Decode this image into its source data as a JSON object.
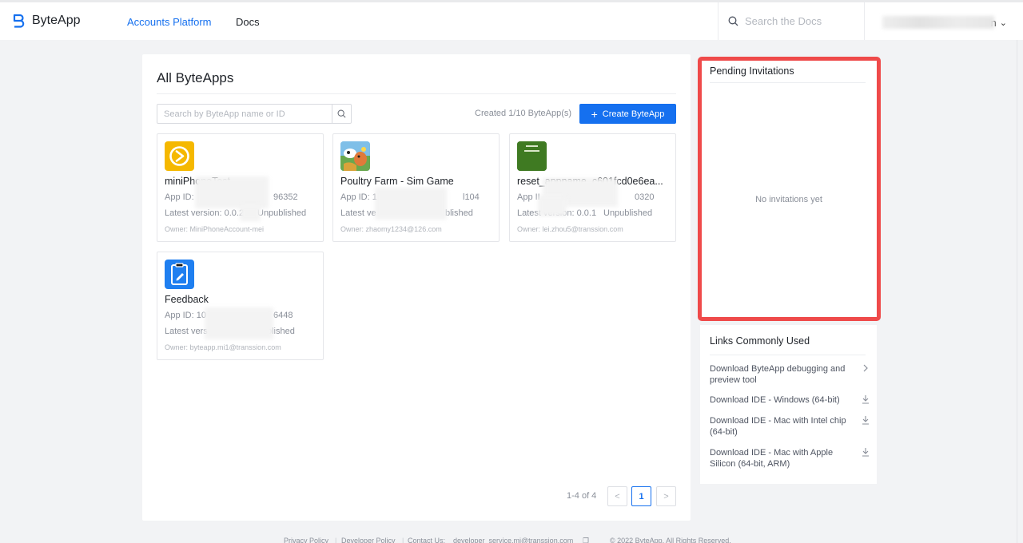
{
  "header": {
    "logo_text": "ByteApp",
    "nav": [
      {
        "label": "Accounts Platform",
        "active": true
      },
      {
        "label": "Docs",
        "active": false
      }
    ],
    "search_placeholder": "Search the Docs",
    "user_suffix": "n"
  },
  "main": {
    "title": "All ByteApps",
    "search_placeholder": "Search by ByteApp name or ID",
    "created_count": "Created 1/10 ByteApp(s)",
    "create_button": "Create ByteApp",
    "apps": [
      {
        "name": "miniPhoneTest",
        "app_id": "App ID:",
        "app_id_tail": "96352",
        "version": "Latest version: 0.0.2",
        "version_tail": "Unpublished",
        "owner": "Owner: MiniPhoneAccount-mei",
        "icon": "play-circle-icon",
        "color": "#f5b800"
      },
      {
        "name": "Poultry Farm - Sim Game",
        "app_id": "App ID: 1",
        "app_id_tail": "l104",
        "version": "Latest ve",
        "version_tail": "blished",
        "owner": "Owner: zhaomy1234@126.com",
        "icon": "farm-game-icon",
        "color": "#6aa84f"
      },
      {
        "name": "reset_appname_c601fcd0e6ea...",
        "app_id": "App II",
        "app_id_tail": "0320",
        "version": "Latest version: 0.0.1",
        "version_tail": "Unpublished",
        "owner": "Owner: lei.zhou5@transsion.com",
        "icon": "green-square-icon",
        "color": "#3f7a22"
      },
      {
        "name": "Feedback",
        "app_id": "App ID: 10",
        "app_id_tail": "6448",
        "version": "Latest vers",
        "version_tail": "blished",
        "owner": "Owner: byteapp.mi1@transsion.com",
        "icon": "clipboard-edit-icon",
        "color": "#1f7ff0"
      }
    ],
    "pagination": {
      "info": "1-4 of 4",
      "current": "1",
      "prev": "<",
      "next": ">"
    }
  },
  "invitations": {
    "title": "Pending Invitations",
    "empty_text": "No invitations yet"
  },
  "links": {
    "title": "Links Commonly Used",
    "items": [
      {
        "label": "Download ByteApp debugging and preview tool",
        "icon": "chevron-right-icon"
      },
      {
        "label": "Download IDE - Windows (64-bit)",
        "icon": "download-icon"
      },
      {
        "label": "Download IDE - Mac with Intel chip (64-bit)",
        "icon": "download-icon"
      },
      {
        "label": "Download IDE - Mac with Apple Silicon (64-bit, ARM)",
        "icon": "download-icon"
      }
    ]
  },
  "footer": {
    "privacy": "Privacy Policy",
    "developer_policy": "Developer Policy",
    "contact": "Contact Us:",
    "email": "developer_service.mi@transsion.com",
    "copyright": "© 2022 ByteApp. All Rights Reserved."
  },
  "colors": {
    "accent": "#1570ef",
    "highlight": "#ef4a4a"
  }
}
